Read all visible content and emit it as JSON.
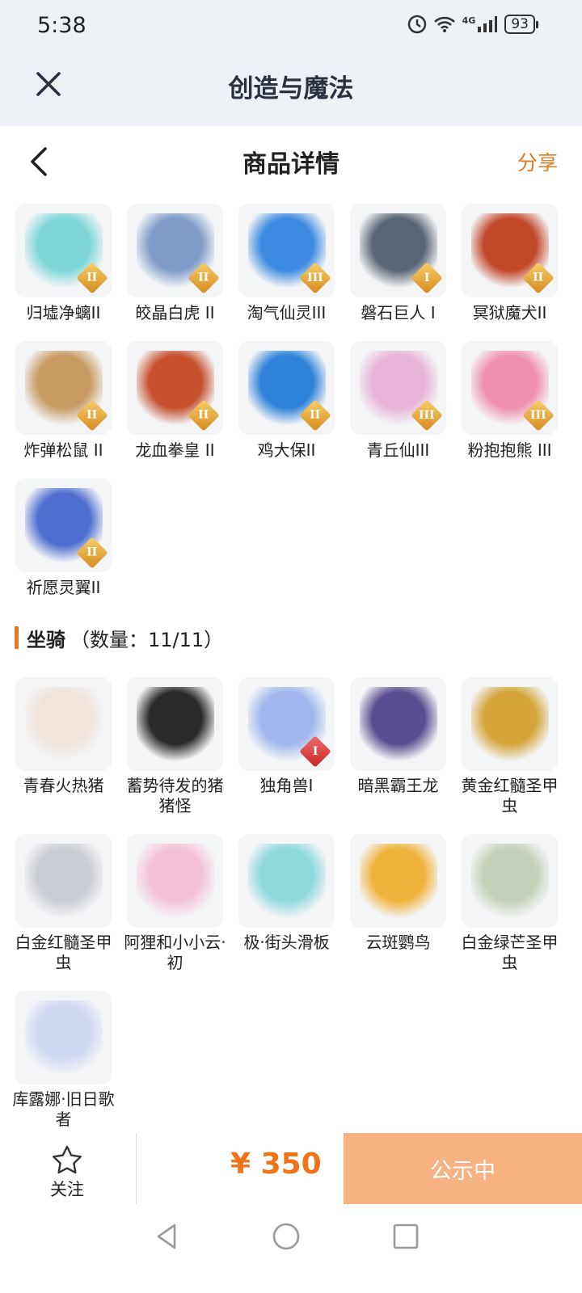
{
  "status": {
    "time": "5:38",
    "network": "4G",
    "battery": "93"
  },
  "app": {
    "title": "创造与魔法"
  },
  "page": {
    "title": "商品详情",
    "share_label": "分享"
  },
  "pets": [
    {
      "name": "归墟净螭II",
      "tier": "II",
      "badge": "gold",
      "color": "#7fd6d8"
    },
    {
      "name": "皎晶白虎 II",
      "tier": "II",
      "badge": "gold",
      "color": "#7f9cc8"
    },
    {
      "name": "淘气仙灵III",
      "tier": "III",
      "badge": "gold",
      "color": "#3d8be0"
    },
    {
      "name": "磐石巨人 I",
      "tier": "I",
      "badge": "gold",
      "color": "#5a6674"
    },
    {
      "name": "冥狱魔犬II",
      "tier": "II",
      "badge": "gold",
      "color": "#c2482a"
    },
    {
      "name": "炸弹松鼠 II",
      "tier": "II",
      "badge": "gold",
      "color": "#c89a64"
    },
    {
      "name": "龙血拳皇 II",
      "tier": "II",
      "badge": "gold",
      "color": "#c5502e"
    },
    {
      "name": "鸡大保II",
      "tier": "II",
      "badge": "gold",
      "color": "#2e82d8"
    },
    {
      "name": "青丘仙III",
      "tier": "III",
      "badge": "gold",
      "color": "#e7b3d6"
    },
    {
      "name": "粉抱抱熊 III",
      "tier": "III",
      "badge": "gold",
      "color": "#f08fb0"
    },
    {
      "name": "祈愿灵翼II",
      "tier": "II",
      "badge": "gold",
      "color": "#4f6fd0"
    }
  ],
  "mounts_section": {
    "label": "坐骑",
    "count": "（数量：11/11）"
  },
  "mounts": [
    {
      "name": "青春火热猪",
      "tier": "",
      "badge": "",
      "color": "#f1e4dc"
    },
    {
      "name": "蓄势待发的猪猪怪",
      "tier": "",
      "badge": "",
      "color": "#2a2a2a"
    },
    {
      "name": "独角兽I",
      "tier": "I",
      "badge": "red",
      "color": "#9fb7ec"
    },
    {
      "name": "暗黑霸王龙",
      "tier": "",
      "badge": "",
      "color": "#5a4d8f"
    },
    {
      "name": "黄金红髓圣甲虫",
      "tier": "",
      "badge": "",
      "color": "#d4a53a"
    },
    {
      "name": "白金红髓圣甲虫",
      "tier": "",
      "badge": "",
      "color": "#c9ccd3"
    },
    {
      "name": "阿狸和小小云·初",
      "tier": "",
      "badge": "",
      "color": "#f4c2d8"
    },
    {
      "name": "极·街头滑板",
      "tier": "",
      "badge": "",
      "color": "#8fd8dc"
    },
    {
      "name": "云斑鹦鸟",
      "tier": "",
      "badge": "",
      "color": "#f0b33c"
    },
    {
      "name": "白金绿芒圣甲虫",
      "tier": "",
      "badge": "",
      "color": "#c3d0b8"
    },
    {
      "name": "库露娜·旧日歌者",
      "tier": "",
      "badge": "",
      "color": "#cfd7f2"
    }
  ],
  "bottom": {
    "follow_label": "关注",
    "price": "¥ 350",
    "cta_label": "公示中"
  },
  "colors": {
    "accent": "#e07b24",
    "price": "#f07318",
    "cta_bg": "#f7b283",
    "header_bg": "#eef2f6"
  }
}
